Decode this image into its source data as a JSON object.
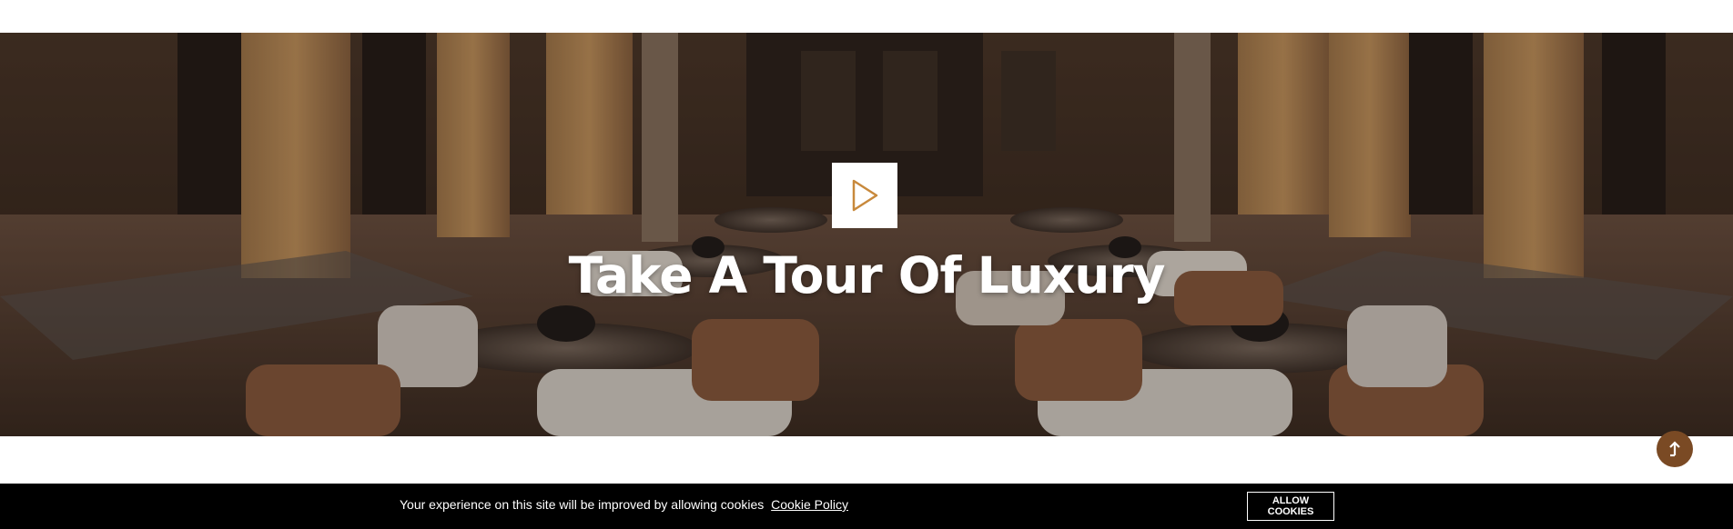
{
  "hero": {
    "title": "Take A Tour Of Luxury",
    "image_icon": "lounge-interior-image",
    "play_icon": "play-icon"
  },
  "scroll_top": {
    "icon": "arrow-up-icon"
  },
  "cookie_bar": {
    "message": "Your experience on this site will be improved by allowing cookies",
    "policy_link": "Cookie Policy",
    "allow_button": "ALLOW COOKIES"
  },
  "colors": {
    "accent": "#c8893c",
    "scroll_button": "#7a4a24",
    "cookie_bar_bg": "#000000"
  }
}
